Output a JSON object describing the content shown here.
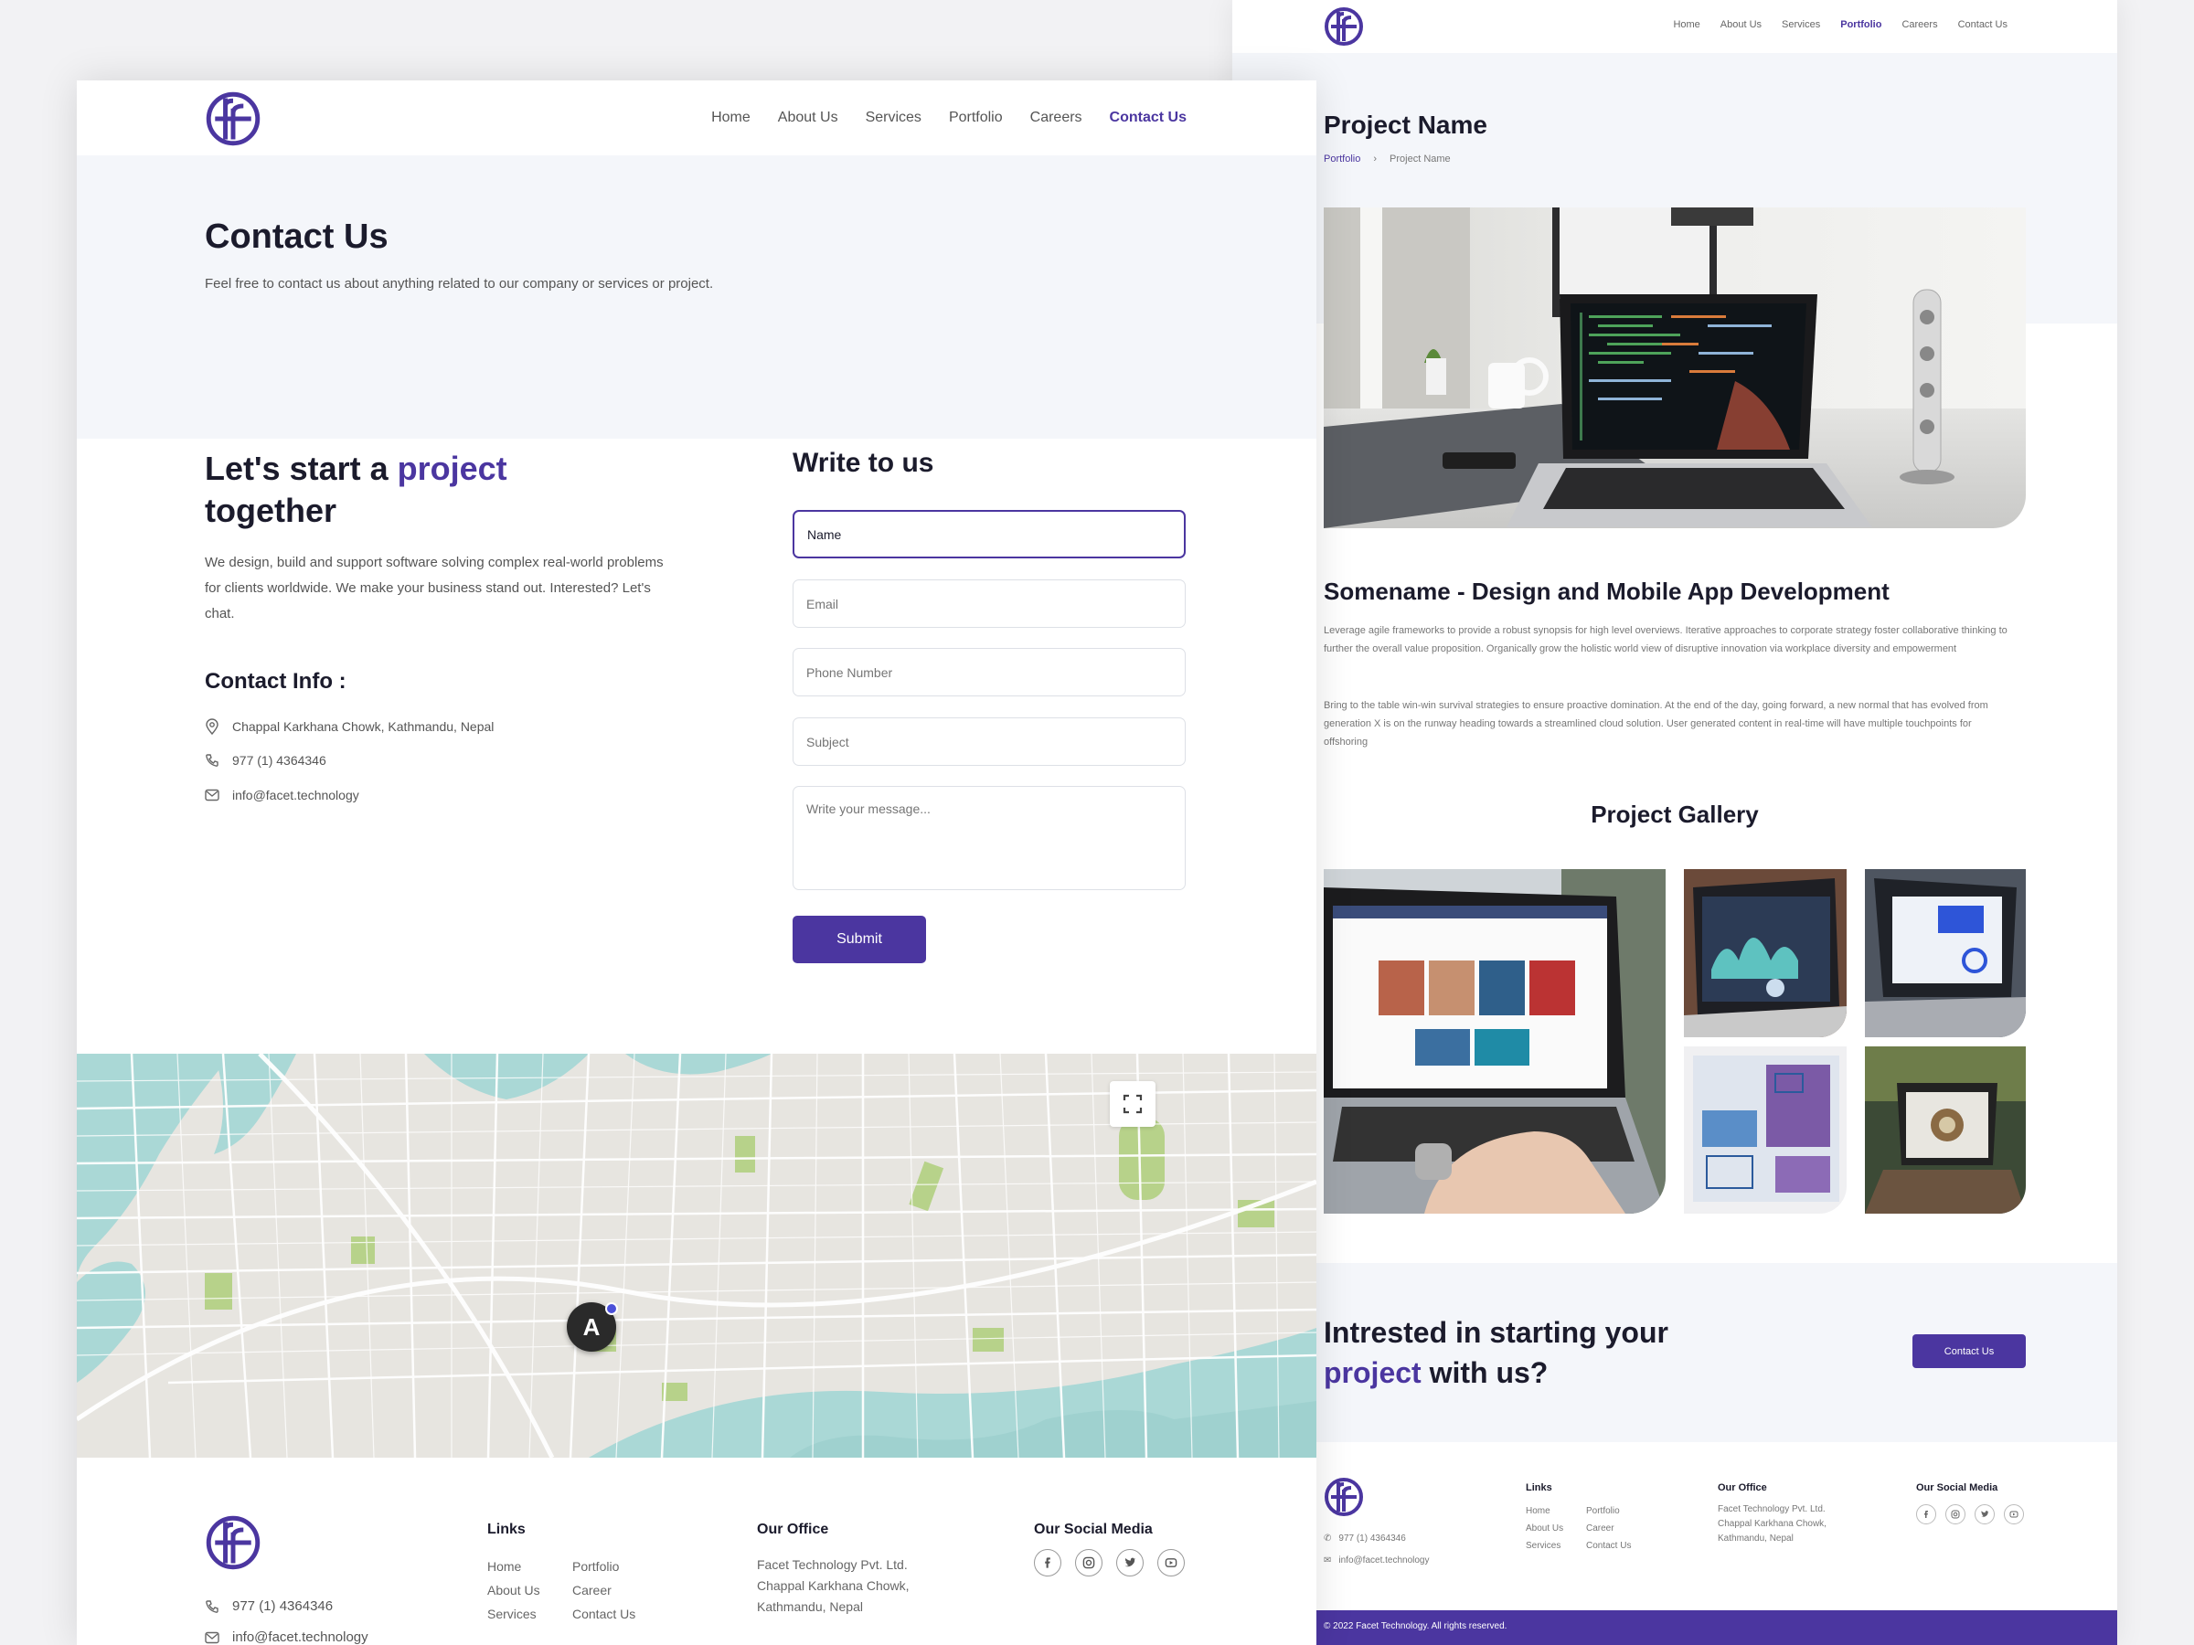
{
  "brand": {
    "accent": "#4b36a0",
    "hero_bg": "#f4f6fa",
    "water": "#aad8d6",
    "park": "#b7d28a"
  },
  "contact_page": {
    "nav": {
      "items": [
        "Home",
        "About Us",
        "Services",
        "Portfolio",
        "Careers",
        "Contact Us"
      ],
      "active": "Contact Us"
    },
    "hero": {
      "title": "Contact Us",
      "subtitle": "Feel free to contact us about anything related to our company or services or project."
    },
    "intro": {
      "heading_pre": "Let's start a ",
      "heading_accent": "project",
      "heading_post": "together",
      "description": "We design, build and support software solving complex real-world problems for clients worldwide. We make your business stand out. Interested? Let's chat."
    },
    "contact_info": {
      "heading": "Contact Info :",
      "address": "Chappal Karkhana Chowk, Kathmandu, Nepal",
      "phone": "977 (1) 4364346",
      "email": "info@facet.technology"
    },
    "form": {
      "heading": "Write to us",
      "name_value": "Name",
      "email_placeholder": "Email",
      "phone_placeholder": "Phone Number",
      "subject_placeholder": "Subject",
      "message_placeholder": "Write your message...",
      "submit_label": "Submit"
    },
    "map": {
      "marker_label": "A"
    },
    "footer": {
      "phone": "977 (1) 4364346",
      "email": "info@facet.technology",
      "links_heading": "Links",
      "links_col1": [
        "Home",
        "About Us",
        "Services"
      ],
      "links_col2": [
        "Portfolio",
        "Career",
        "Contact Us"
      ],
      "office_heading": "Our Office",
      "office_lines": [
        "Facet Technology Pvt. Ltd.",
        "Chappal Karkhana Chowk,",
        "Kathmandu, Nepal"
      ],
      "social_heading": "Our Social Media",
      "social_icons": [
        "facebook-icon",
        "instagram-icon",
        "twitter-icon",
        "youtube-icon"
      ]
    }
  },
  "project_page": {
    "nav": {
      "items": [
        "Home",
        "About Us",
        "Services",
        "Portfolio",
        "Careers",
        "Contact Us"
      ],
      "active": "Portfolio"
    },
    "title": "Project Name",
    "breadcrumb": [
      "Portfolio",
      "Project Name"
    ],
    "project_heading": "Somename - Design and Mobile App Development",
    "paragraph1": "Leverage agile frameworks to provide a robust synopsis for high level overviews. Iterative approaches to corporate strategy foster collaborative thinking to further the overall value proposition. Organically grow the holistic world view of disruptive innovation via workplace diversity and empowerment",
    "paragraph2": "Bring to the table win-win survival strategies to ensure proactive domination. At the end of the day, going forward, a new normal that has evolved from generation X is on the runway heading towards a streamlined cloud solution. User generated content in real-time will have multiple touchpoints for offshoring",
    "gallery_title": "Project Gallery",
    "cta": {
      "line1": "Intrested in starting your",
      "accent": "project",
      "line2_rest": " with us?",
      "button": "Contact Us"
    },
    "footer": {
      "phone": "977 (1) 4364346",
      "email": "info@facet.technology",
      "links_heading": "Links",
      "links_col1": [
        "Home",
        "About Us",
        "Services"
      ],
      "links_col2": [
        "Portfolio",
        "Career",
        "Contact Us"
      ],
      "office_heading": "Our Office",
      "office_lines": [
        "Facet Technology Pvt. Ltd.",
        "Chappal Karkhana Chowk,",
        "Kathmandu, Nepal"
      ],
      "social_heading": "Our Social Media",
      "copyright": "© 2022 Facet Technology. All rights reserved."
    }
  }
}
